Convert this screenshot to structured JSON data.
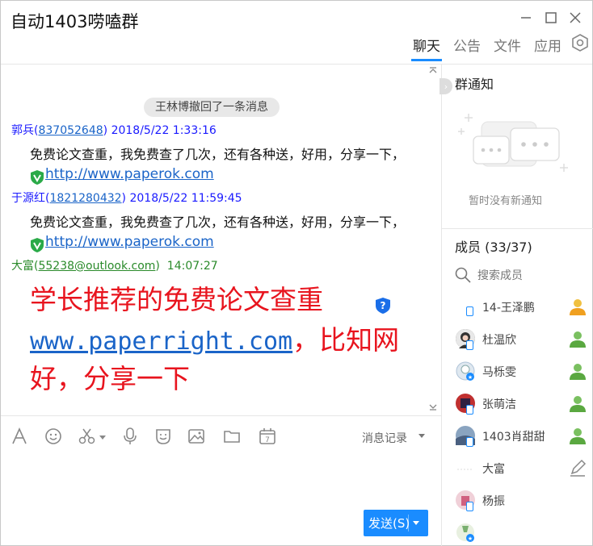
{
  "window": {
    "title": "自动1403唠嗑群",
    "tabs": [
      "聊天",
      "公告",
      "文件",
      "应用"
    ],
    "active_tab": "聊天"
  },
  "chat": {
    "recall_notice": "王林博撤回了一条消息",
    "messages": [
      {
        "sender_name": "郭兵",
        "sender_qq": "837052648",
        "time": "2018/5/22 1:33:16",
        "text": "免费论文查重，我免费查了几次，还有各种送，好用，分享一下，",
        "link": "http://www.paperok.com"
      },
      {
        "sender_name": "于源红",
        "sender_qq": "1821280432",
        "time": "2018/5/22 11:59:45",
        "text": "免费论文查重，我免费查了几次，还有各种送，好用，分享一下，",
        "link": "http://www.paperok.com"
      }
    ],
    "big_message": {
      "sender_name": "大富",
      "sender_qq": "55238@outlook.com",
      "time": "14:07:27",
      "line1": "学长推荐的免费论文查重",
      "link": "www.paperright.com",
      "line2_suffix": "，比知网",
      "line3": "好，分享一下"
    }
  },
  "toolbar": {
    "history_label": "消息记录",
    "send_label": "发送(S)"
  },
  "side": {
    "notice_title": "群通知",
    "notice_empty": "暂时没有新通知",
    "members_title": "成员 (33/37)",
    "search_placeholder": "搜索成员",
    "members": [
      {
        "name": "14-王泽鹏",
        "phone": true,
        "badge": "member"
      },
      {
        "name": "杜温欣",
        "phone": true,
        "badge": "member"
      },
      {
        "name": "马栎雯",
        "phone": false,
        "badge": "member"
      },
      {
        "name": "张萌洁",
        "phone": true,
        "badge": "member"
      },
      {
        "name": "1403肖甜甜",
        "phone": true,
        "badge": "member"
      },
      {
        "name": "大富",
        "phone": false,
        "badge": "edit"
      },
      {
        "name": "杨振",
        "phone": true,
        "badge": "none"
      },
      {
        "name": "",
        "phone": false,
        "badge": "none"
      }
    ]
  },
  "colors": {
    "accent": "#1a8cff",
    "big_text": "#e8141e",
    "link": "#1a64c8",
    "sender": "#1a1aff",
    "sender_green": "#2a8a2a"
  }
}
